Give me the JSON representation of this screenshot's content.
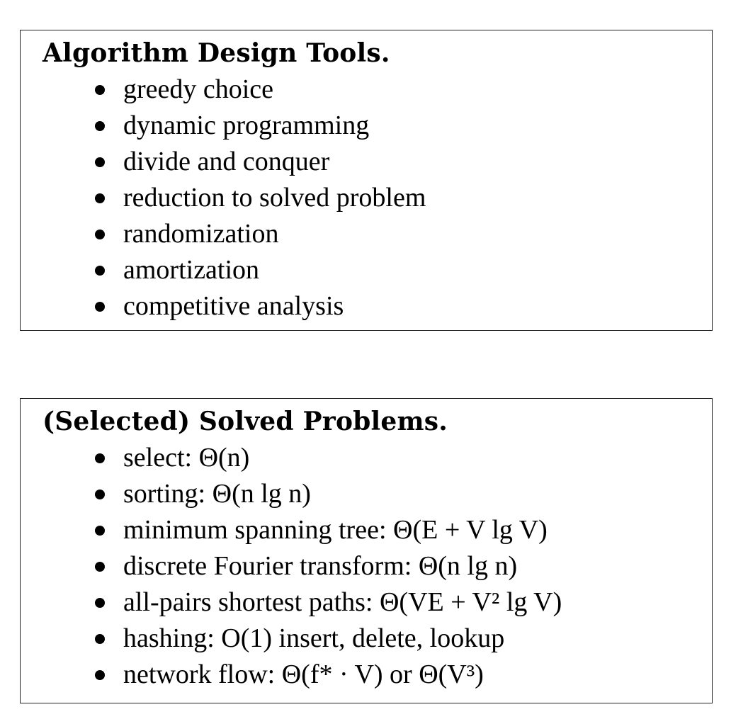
{
  "design_tools": {
    "title": "Algorithm Design Tools.",
    "items": [
      "greedy choice",
      "dynamic programming",
      "divide and conquer",
      "reduction to solved problem",
      "randomization",
      "amortization",
      "competitive analysis"
    ]
  },
  "solved_problems": {
    "title": "(Selected) Solved Problems.",
    "items": [
      {
        "label": "select:",
        "bound": "Θ(n)"
      },
      {
        "label": "sorting:",
        "bound": "Θ(n lg n)"
      },
      {
        "label": "minimum spanning tree:",
        "bound": "Θ(E + V lg V)"
      },
      {
        "label": "discrete Fourier transform:",
        "bound": "Θ(n lg n)"
      },
      {
        "label": "all-pairs shortest paths:",
        "bound": "Θ(VE + V² lg V)"
      },
      {
        "label": "hashing:",
        "bound": "O(1) insert, delete, lookup"
      },
      {
        "label": "network flow:",
        "bound": "Θ(f* · V) or Θ(V³)"
      }
    ]
  }
}
